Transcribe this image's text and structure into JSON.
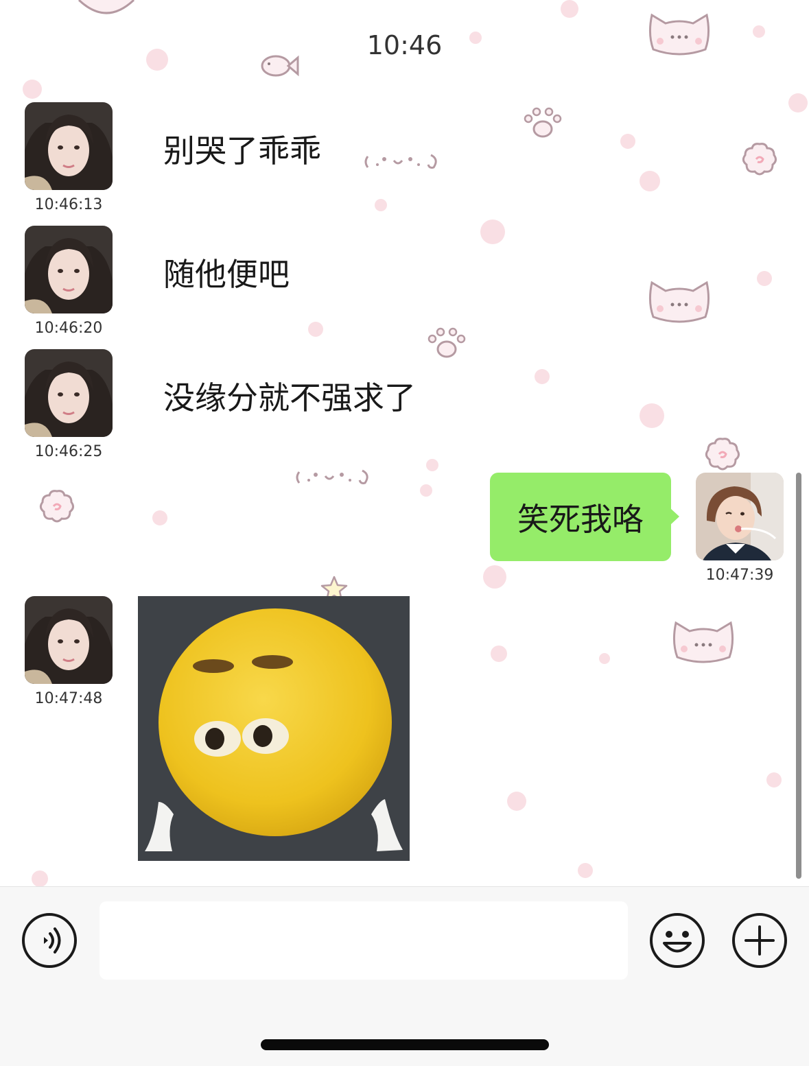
{
  "chat": {
    "time_divider": "10:46",
    "messages": [
      {
        "direction": "in",
        "type": "text",
        "text": "别哭了乖乖",
        "time": "10:46:13"
      },
      {
        "direction": "in",
        "type": "text",
        "text": "随他便吧",
        "time": "10:46:20"
      },
      {
        "direction": "in",
        "type": "text",
        "text": "没缘分就不强求了",
        "time": "10:46:25"
      },
      {
        "direction": "out",
        "type": "text",
        "text": "笑死我咯",
        "time": "10:47:39"
      },
      {
        "direction": "in",
        "type": "sticker",
        "sticker": "yellow-emoji-sticker",
        "time": "10:47:48"
      }
    ]
  },
  "colors": {
    "outgoing_bubble": "#95ec69",
    "background_decor": "#f9dfe4",
    "input_bar": "#f7f7f7"
  },
  "input_bar": {
    "icons": [
      "voice-icon",
      "emoji-icon",
      "plus-icon"
    ]
  }
}
